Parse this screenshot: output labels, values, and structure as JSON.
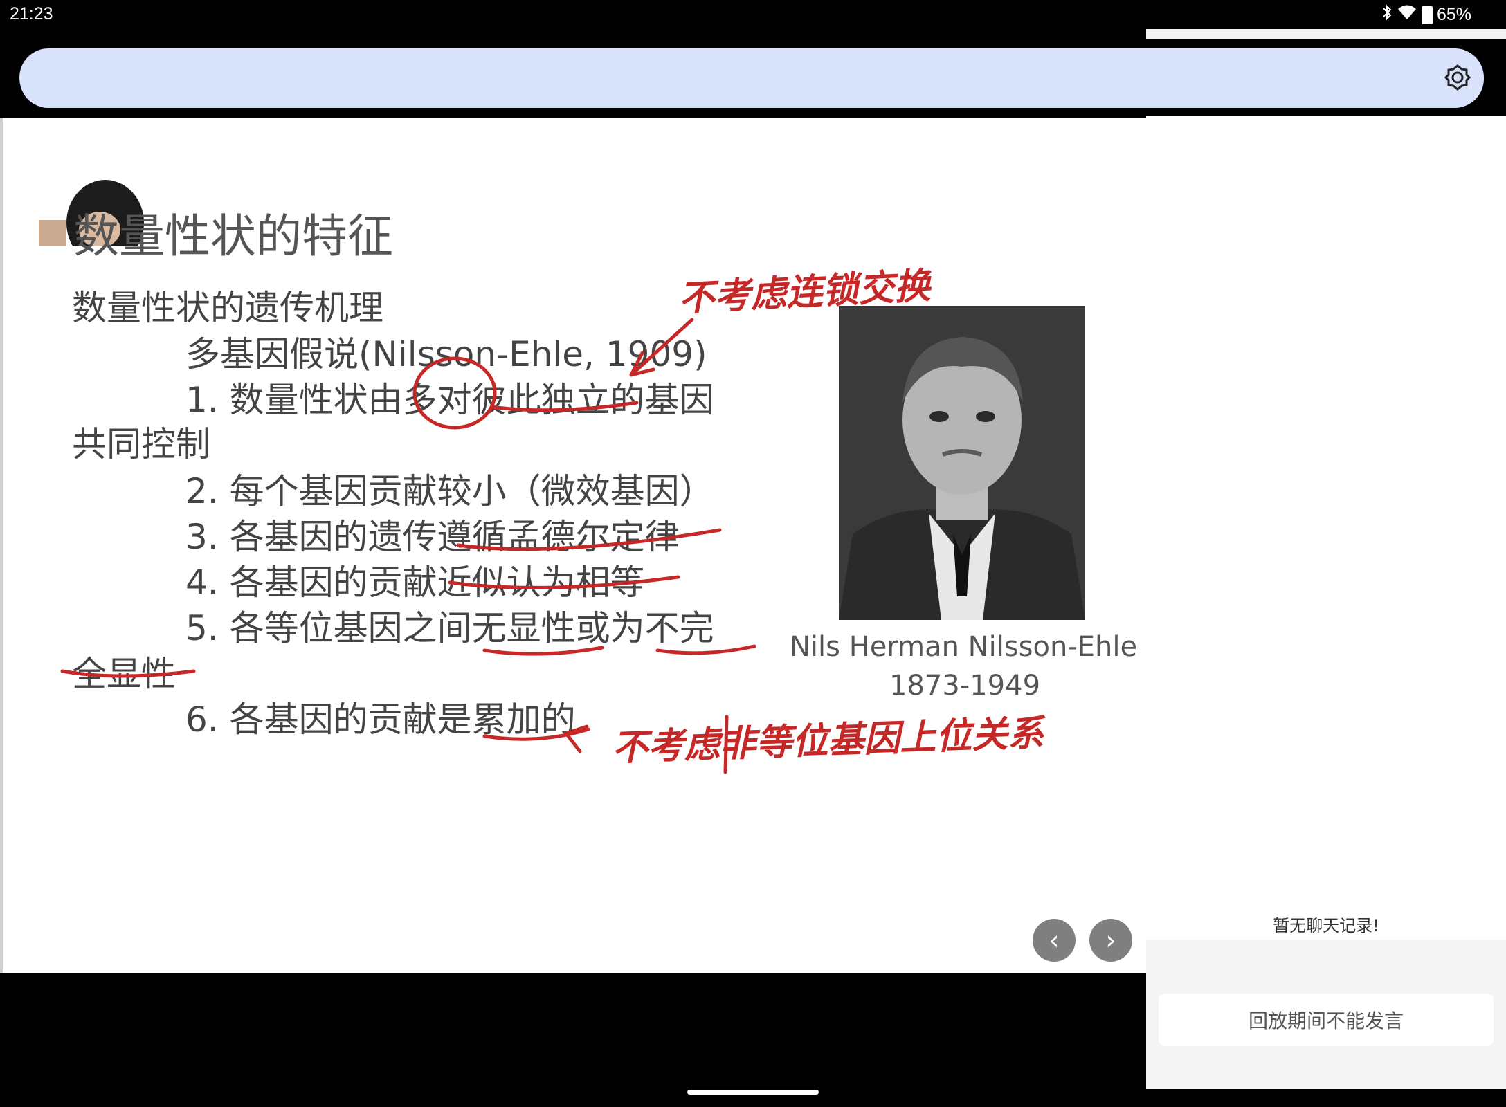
{
  "status_bar": {
    "time": "21:23",
    "battery_percent": "65%",
    "icons": [
      "bluetooth-icon",
      "wifi-icon",
      "battery-icon"
    ]
  },
  "search_bar": {
    "placeholder": "",
    "icon": "brightness-icon"
  },
  "slide": {
    "title": "数量性状的特征",
    "lines": [
      "数量性状的遗传机理",
      "多基因假说(Nilsson-Ehle, 1909)",
      "1. 数量性状由多对彼此独立的基因",
      "共同控制",
      "2. 每个基因贡献较小（微效基因）",
      "3. 各基因的遗传遵循孟德尔定律",
      "4. 各基因的贡献近似认为相等",
      "5. 各等位基因之间无显性或为不完",
      "全显性",
      "6. 各基因的贡献是累加的"
    ],
    "portrait_caption_name": "Nils Herman Nilsson-Ehle",
    "portrait_caption_years": "1873-1949",
    "annotations": {
      "top": "不考虑连锁交换",
      "bottom": "不考虑非等位基因上位关系"
    },
    "nav": {
      "prev": "‹",
      "next": "›"
    }
  },
  "chat_panel": {
    "empty_message": "暂无聊天记录!",
    "input_disabled_text": "回放期间不能发言"
  },
  "colors": {
    "search_bar_bg": "#d9e2fb",
    "annotation": "#c62828"
  }
}
